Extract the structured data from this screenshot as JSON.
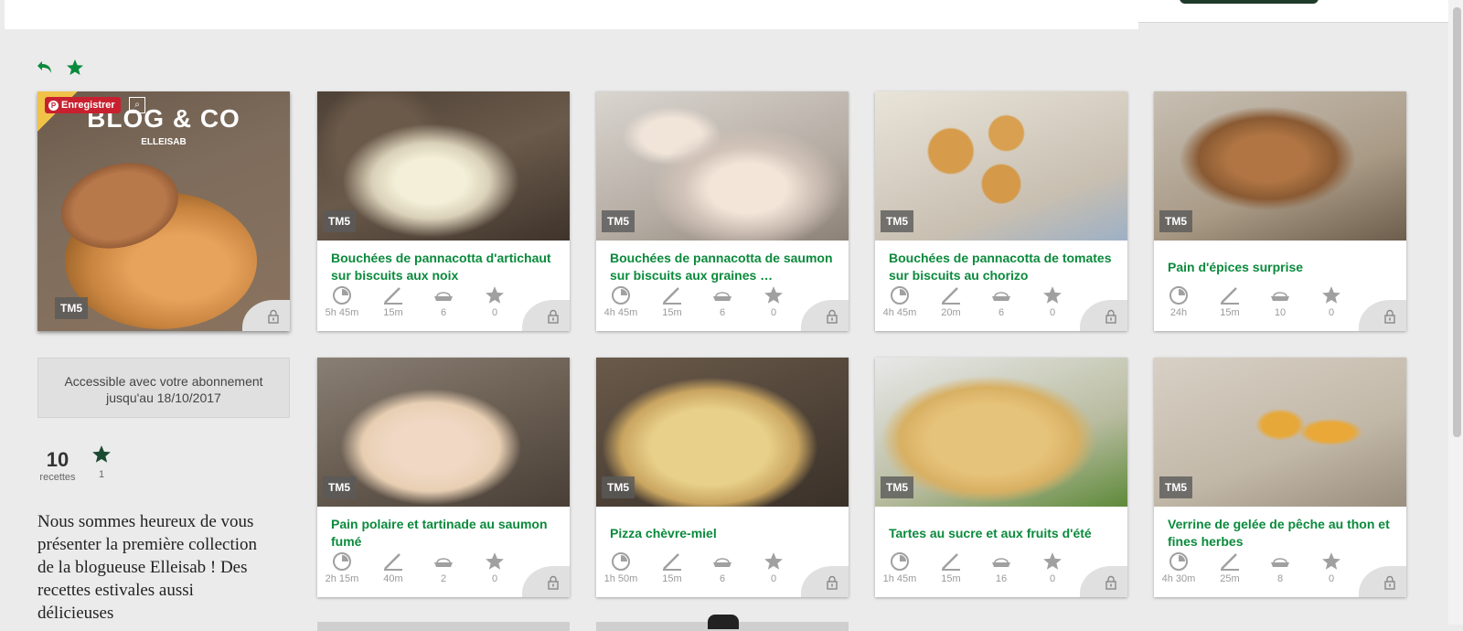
{
  "cover": {
    "title": "BLOG & CO",
    "subtitle": "ELLEISAB",
    "badge": "TM5",
    "pinterest_label": "Enregistrer"
  },
  "access": {
    "line1": "Accessible avec votre abonnement",
    "line2": "jusqu'au 18/10/2017"
  },
  "stats": {
    "recipes_count": "10",
    "recipes_label": "recettes",
    "favorites_count": "1"
  },
  "description": "Nous sommes heureux de vous présenter la première collection de la blogueuse Elleisab ! Des recettes estivales aussi délicieuses",
  "recipes": [
    {
      "name": "Bouchées de pannacotta d'artichaut sur biscuits aux noix",
      "badge": "TM5",
      "total": "5h 45m",
      "prep": "15m",
      "servings": "6",
      "rating": "0"
    },
    {
      "name": "Bouchées de pannacotta de saumon sur biscuits aux graines …",
      "badge": "TM5",
      "total": "4h 45m",
      "prep": "15m",
      "servings": "6",
      "rating": "0"
    },
    {
      "name": "Bouchées de pannacotta de tomates sur biscuits au chorizo",
      "badge": "TM5",
      "total": "4h 45m",
      "prep": "20m",
      "servings": "6",
      "rating": "0"
    },
    {
      "name": "Pain d'épices surprise",
      "badge": "TM5",
      "total": "24h",
      "prep": "15m",
      "servings": "10",
      "rating": "0"
    },
    {
      "name": "Pain polaire et tartinade au saumon fumé",
      "badge": "TM5",
      "total": "2h 15m",
      "prep": "40m",
      "servings": "2",
      "rating": "0"
    },
    {
      "name": "Pizza chèvre-miel",
      "badge": "TM5",
      "total": "1h 50m",
      "prep": "15m",
      "servings": "6",
      "rating": "0"
    },
    {
      "name": "Tartes au sucre et aux fruits d'été",
      "badge": "TM5",
      "total": "1h 45m",
      "prep": "15m",
      "servings": "16",
      "rating": "0"
    },
    {
      "name": "Verrine de gelée de pêche au thon et fines herbes",
      "badge": "TM5",
      "total": "4h 30m",
      "prep": "25m",
      "servings": "8",
      "rating": "0"
    }
  ],
  "colors": {
    "accent": "#0a8a3c",
    "background": "#ebebeb"
  }
}
